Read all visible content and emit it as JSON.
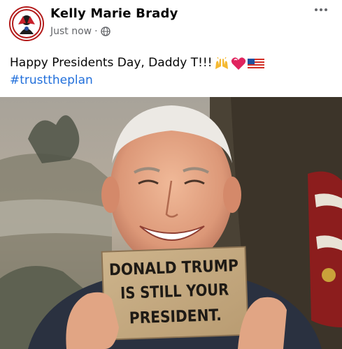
{
  "post": {
    "author_name": "Kelly Marie Brady",
    "timestamp": "Just now",
    "separator": "·",
    "audience_icon": "globe-icon",
    "more_icon": "more-options-icon",
    "text_line1": "Happy Presidents Day, Daddy T!!!",
    "emojis": [
      "raising-hands-emoji",
      "heart-emoji",
      "us-flag-emoji"
    ],
    "hashtag": "#trusttheplan"
  },
  "photo": {
    "sign_line1": "DONALD TRUMP",
    "sign_line2": "IS STILL YOUR",
    "sign_line3": "PRESIDENT."
  },
  "colors": {
    "text": "#050505",
    "meta": "#65676b",
    "hashtag": "#216fdb",
    "avatar_border": "#b31b1b"
  }
}
